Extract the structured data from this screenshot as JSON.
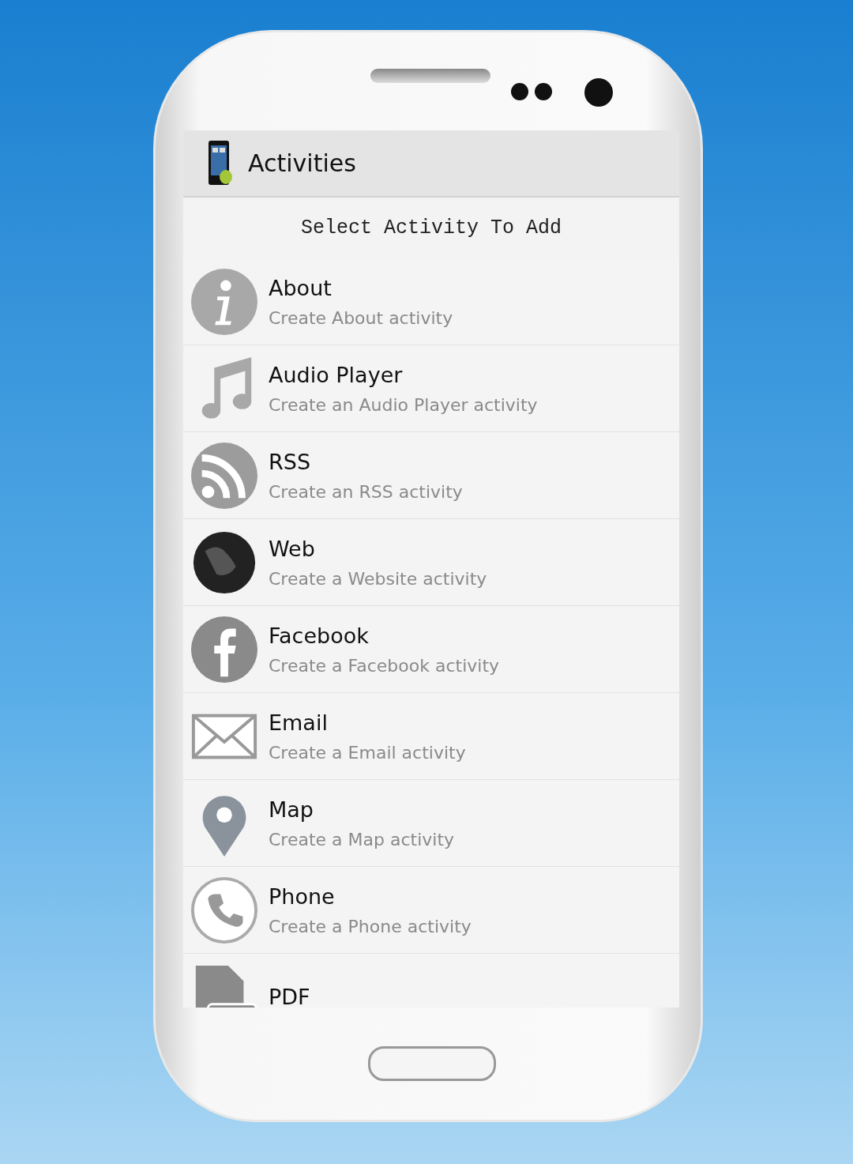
{
  "app_bar": {
    "title": "Activities"
  },
  "heading": "Select Activity To Add",
  "activities": [
    {
      "kind": "info",
      "title": "About",
      "subtitle": "Create About activity"
    },
    {
      "kind": "music",
      "title": "Audio Player",
      "subtitle": "Create an Audio Player activity"
    },
    {
      "kind": "rss",
      "title": "RSS",
      "subtitle": "Create an RSS activity"
    },
    {
      "kind": "globe",
      "title": "Web",
      "subtitle": "Create a Website activity"
    },
    {
      "kind": "facebook",
      "title": "Facebook",
      "subtitle": "Create a Facebook activity"
    },
    {
      "kind": "email",
      "title": "Email",
      "subtitle": "Create a Email activity"
    },
    {
      "kind": "map",
      "title": "Map",
      "subtitle": "Create a Map activity"
    },
    {
      "kind": "phone",
      "title": "Phone",
      "subtitle": "Create a Phone activity"
    },
    {
      "kind": "pdf",
      "title": "PDF"
    }
  ]
}
